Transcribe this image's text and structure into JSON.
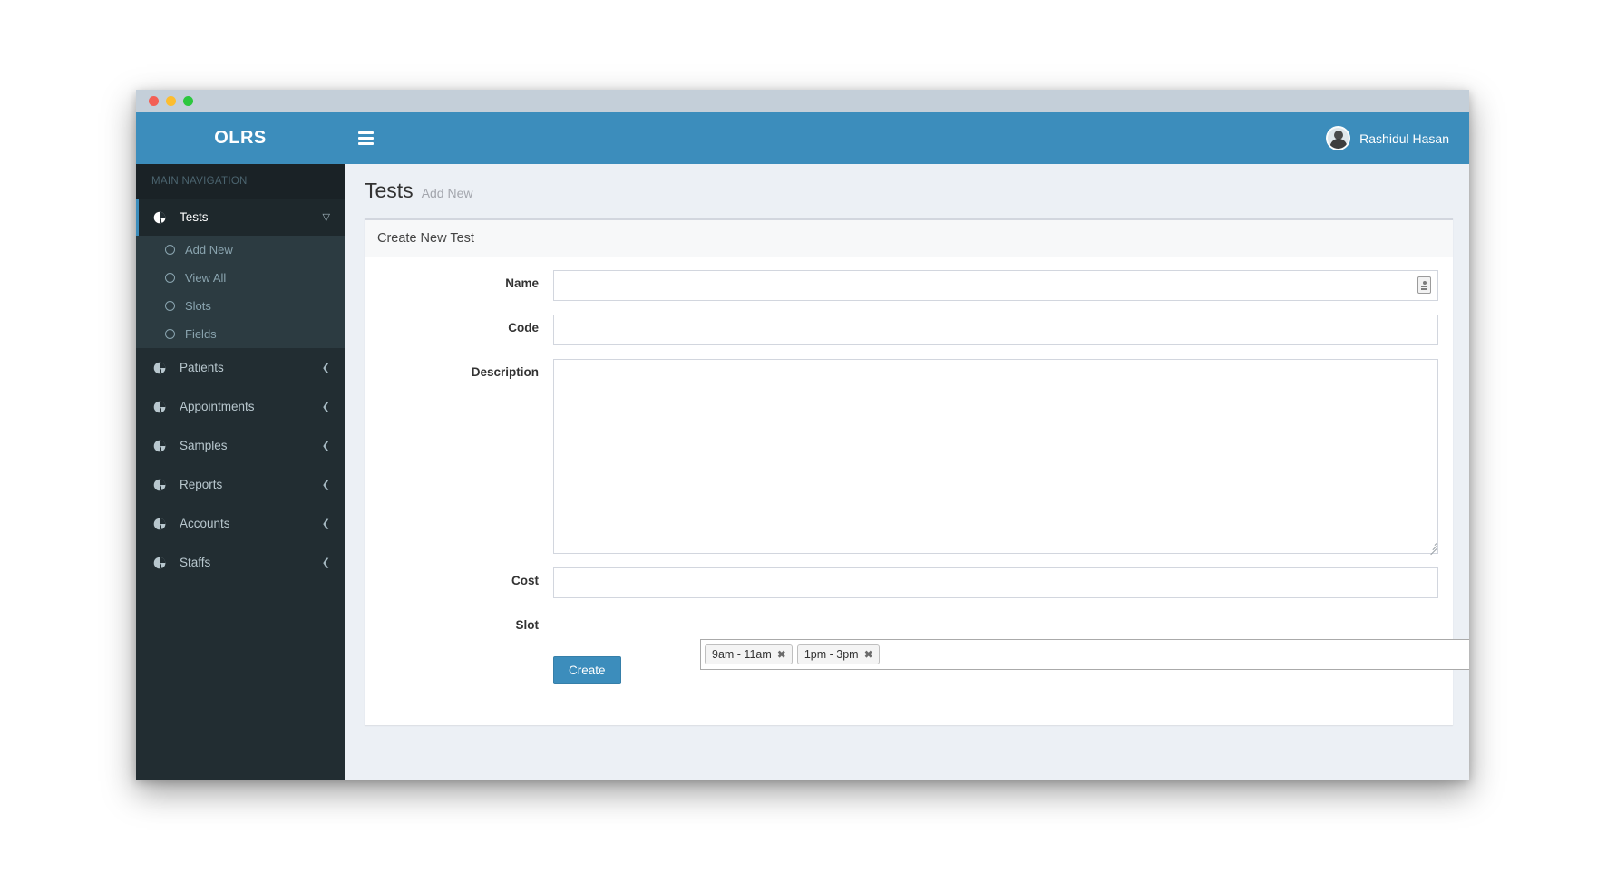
{
  "window": {
    "traffic_lights": [
      "close",
      "minimize",
      "maximize"
    ]
  },
  "sidebar": {
    "logo": "OLRS",
    "nav_header": "MAIN NAVIGATION",
    "items": [
      {
        "label": "Tests",
        "icon": "pie-chart-icon",
        "active": true,
        "chevron": "chevron-down-icon",
        "submenu": [
          {
            "label": "Add New",
            "icon": "circle-o-icon"
          },
          {
            "label": "View All",
            "icon": "circle-o-icon"
          },
          {
            "label": "Slots",
            "icon": "circle-o-icon"
          },
          {
            "label": "Fields",
            "icon": "circle-o-icon"
          }
        ]
      },
      {
        "label": "Patients",
        "icon": "pie-chart-icon",
        "active": false,
        "chevron": "chevron-left-icon"
      },
      {
        "label": "Appointments",
        "icon": "pie-chart-icon",
        "active": false,
        "chevron": "chevron-left-icon"
      },
      {
        "label": "Samples",
        "icon": "pie-chart-icon",
        "active": false,
        "chevron": "chevron-left-icon"
      },
      {
        "label": "Reports",
        "icon": "pie-chart-icon",
        "active": false,
        "chevron": "chevron-left-icon"
      },
      {
        "label": "Accounts",
        "icon": "pie-chart-icon",
        "active": false,
        "chevron": "chevron-left-icon"
      },
      {
        "label": "Staffs",
        "icon": "pie-chart-icon",
        "active": false,
        "chevron": "chevron-left-icon"
      }
    ]
  },
  "topbar": {
    "menu_toggle_icon": "hamburger-icon",
    "user_name": "Rashidul Hasan",
    "avatar_icon": "user-avatar"
  },
  "page": {
    "title": "Tests",
    "subtitle": "Add New"
  },
  "card": {
    "title": "Create New Test"
  },
  "form": {
    "name": {
      "label": "Name",
      "value": "",
      "placeholder": "",
      "addon_icon": "autofill-card-icon"
    },
    "code": {
      "label": "Code",
      "value": "",
      "placeholder": ""
    },
    "description": {
      "label": "Description",
      "value": "",
      "placeholder": ""
    },
    "cost": {
      "label": "Cost",
      "value": "",
      "placeholder": ""
    },
    "slot": {
      "label": "Slot",
      "tags": [
        {
          "label": "9am - 11am",
          "remove_icon": "close-icon"
        },
        {
          "label": "1pm - 3pm",
          "remove_icon": "close-icon"
        }
      ]
    },
    "submit": {
      "label": "Create"
    }
  },
  "colors": {
    "brand_blue": "#3c8dbc",
    "sidebar_bg": "#222d32",
    "sidebar_submenu_bg": "#2c3b41",
    "sidebar_header_bg": "#1a2226",
    "content_bg": "#ecf0f5",
    "titlebar_bg": "#c4cfd9",
    "traffic_red": "#f35f55",
    "traffic_yellow": "#fcbd2f",
    "traffic_green": "#2cc73e"
  }
}
